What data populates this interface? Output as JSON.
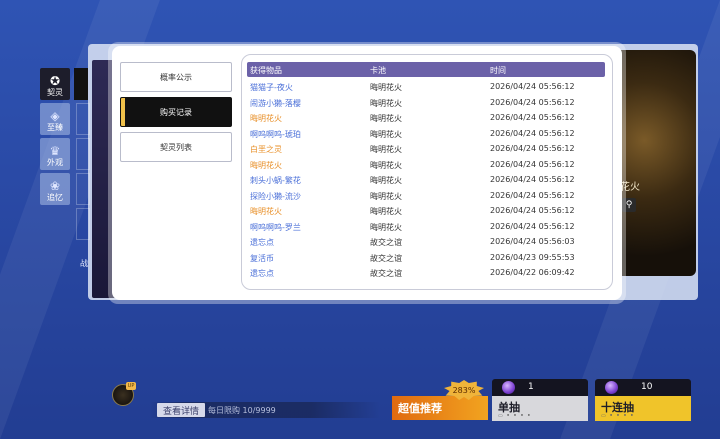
{
  "nav": {
    "items": [
      {
        "label": "契灵",
        "icon": "spirit-icon",
        "active": true
      },
      {
        "label": "至臻",
        "icon": "gem-icon",
        "active": false
      },
      {
        "label": "外观",
        "icon": "outfit-icon",
        "active": false
      },
      {
        "label": "追忆",
        "icon": "memory-icon",
        "active": false
      }
    ],
    "bottom_label": "战"
  },
  "side_menu": {
    "probability": "概率公示",
    "purchase_history": "购买记录",
    "spirit_list": "契灵列表"
  },
  "table": {
    "headers": [
      "获得物品",
      "卡池",
      "时间"
    ],
    "rows": [
      {
        "item": "猫猫子-夜火",
        "pool": "晦明花火",
        "time": "2026/04/24 05:56:12",
        "color": "blue"
      },
      {
        "item": "闹游小獭-落樱",
        "pool": "晦明花火",
        "time": "2026/04/24 05:56:12",
        "color": "blue"
      },
      {
        "item": "晦明花火",
        "pool": "晦明花火",
        "time": "2026/04/24 05:56:12",
        "color": "orange"
      },
      {
        "item": "啊呜啊呜-琥珀",
        "pool": "晦明花火",
        "time": "2026/04/24 05:56:12",
        "color": "blue"
      },
      {
        "item": "白垩之灵",
        "pool": "晦明花火",
        "time": "2026/04/24 05:56:12",
        "color": "orange"
      },
      {
        "item": "晦明花火",
        "pool": "晦明花火",
        "time": "2026/04/24 05:56:12",
        "color": "orange"
      },
      {
        "item": "刺头小蜗-繁花",
        "pool": "晦明花火",
        "time": "2026/04/24 05:56:12",
        "color": "blue"
      },
      {
        "item": "探险小獭-流沙",
        "pool": "晦明花火",
        "time": "2026/04/24 05:56:12",
        "color": "blue"
      },
      {
        "item": "晦明花火",
        "pool": "晦明花火",
        "time": "2026/04/24 05:56:12",
        "color": "orange"
      },
      {
        "item": "啊呜啊呜-罗兰",
        "pool": "晦明花火",
        "time": "2026/04/24 05:56:12",
        "color": "blue"
      },
      {
        "item": "遗忘点",
        "pool": "故交之谊",
        "time": "2026/04/24 05:56:03",
        "color": "blue"
      },
      {
        "item": "复活币",
        "pool": "故交之谊",
        "time": "2026/04/23 09:55:53",
        "color": "blue"
      },
      {
        "item": "遗忘点",
        "pool": "故交之谊",
        "time": "2026/04/22 06:09:42",
        "color": "blue"
      }
    ]
  },
  "art": {
    "label": "花火"
  },
  "bottom": {
    "detail_button": "查看详情",
    "daily_limit": "每日限购 10/9999",
    "promo_label": "超值推荐",
    "promo_badge": "283%",
    "single_draw": {
      "label": "单抽",
      "count": "1"
    },
    "ten_draw": {
      "label": "十连抽",
      "count": "10"
    }
  },
  "colors": {
    "blue_item": "#4a6fd8",
    "orange_item": "#e8902a",
    "header_bg": "#6b61a8",
    "single_bg": "#d8d8dc",
    "ten_bg": "#f0c42a"
  }
}
